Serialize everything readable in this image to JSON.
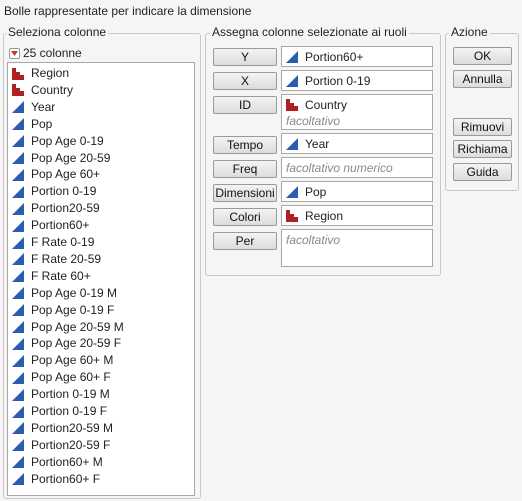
{
  "window": {
    "title": "Bolle rappresentate per indicare la dimensione"
  },
  "select_columns": {
    "label": "Seleziona colonne",
    "count_text": "25 colonne",
    "items": [
      {
        "label": "Region",
        "type": "nominal"
      },
      {
        "label": "Country",
        "type": "nominal"
      },
      {
        "label": "Year",
        "type": "continuous"
      },
      {
        "label": "Pop",
        "type": "continuous"
      },
      {
        "label": "Pop Age 0-19",
        "type": "continuous"
      },
      {
        "label": "Pop Age 20-59",
        "type": "continuous"
      },
      {
        "label": "Pop Age 60+",
        "type": "continuous"
      },
      {
        "label": "Portion 0-19",
        "type": "continuous"
      },
      {
        "label": "Portion20-59",
        "type": "continuous"
      },
      {
        "label": "Portion60+",
        "type": "continuous"
      },
      {
        "label": "F Rate 0-19",
        "type": "continuous"
      },
      {
        "label": "F Rate 20-59",
        "type": "continuous"
      },
      {
        "label": "F Rate 60+",
        "type": "continuous"
      },
      {
        "label": "Pop Age 0-19 M",
        "type": "continuous"
      },
      {
        "label": "Pop Age 0-19 F",
        "type": "continuous"
      },
      {
        "label": "Pop Age 20-59 M",
        "type": "continuous"
      },
      {
        "label": "Pop Age 20-59 F",
        "type": "continuous"
      },
      {
        "label": "Pop Age 60+ M",
        "type": "continuous"
      },
      {
        "label": "Pop Age 60+ F",
        "type": "continuous"
      },
      {
        "label": "Portion 0-19 M",
        "type": "continuous"
      },
      {
        "label": "Portion 0-19 F",
        "type": "continuous"
      },
      {
        "label": "Portion20-59 M",
        "type": "continuous"
      },
      {
        "label": "Portion20-59 F",
        "type": "continuous"
      },
      {
        "label": "Portion60+ M",
        "type": "continuous"
      },
      {
        "label": "Portion60+ F",
        "type": "continuous"
      }
    ]
  },
  "assign_roles": {
    "label": "Assegna colonne selezionate ai ruoli",
    "roles": [
      {
        "button": "Y",
        "entries": [
          {
            "label": "Portion60+",
            "type": "continuous"
          }
        ]
      },
      {
        "button": "X",
        "entries": [
          {
            "label": "Portion 0-19",
            "type": "continuous"
          }
        ]
      },
      {
        "button": "ID",
        "entries": [
          {
            "label": "Country",
            "type": "nominal"
          }
        ],
        "placeholder": "facoltativo"
      },
      {
        "button": "Tempo",
        "entries": [
          {
            "label": "Year",
            "type": "continuous"
          }
        ]
      },
      {
        "button": "Freq",
        "entries": [],
        "placeholder": "facoltativo numerico"
      },
      {
        "button": "Dimensioni",
        "entries": [
          {
            "label": "Pop",
            "type": "continuous"
          }
        ]
      },
      {
        "button": "Colori",
        "entries": [
          {
            "label": "Region",
            "type": "nominal"
          }
        ]
      },
      {
        "button": "Per",
        "entries": [],
        "placeholder": "facoltativo"
      }
    ]
  },
  "actions": {
    "label": "Azione",
    "ok": "OK",
    "cancel": "Annulla",
    "remove": "Rimuovi",
    "recall": "Richiama",
    "help": "Guida"
  },
  "colors": {
    "continuous_icon": "#2a5db0",
    "nominal_icon": "#b02020",
    "dropdown_triangle": "#c0392b"
  }
}
